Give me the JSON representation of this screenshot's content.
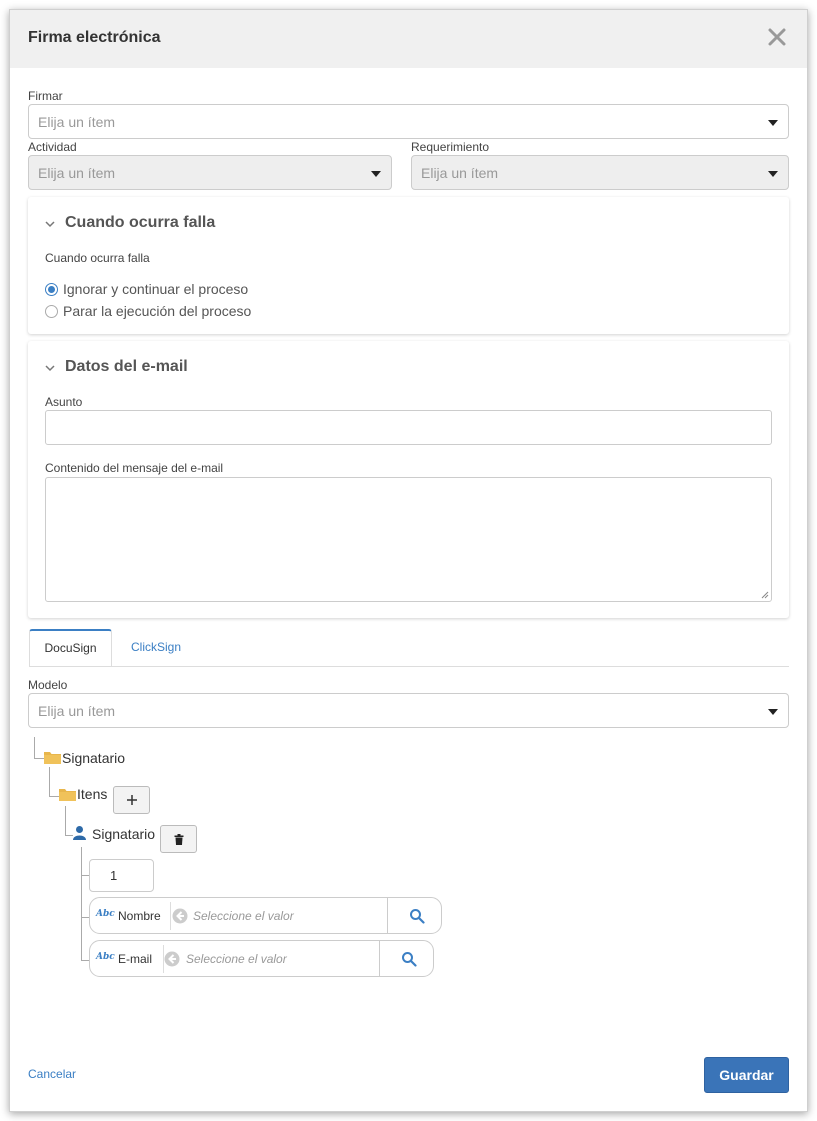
{
  "dialog": {
    "title": "Firma electrónica"
  },
  "firmar": {
    "label": "Firmar",
    "placeholder": "Elija un ítem"
  },
  "actividad": {
    "label": "Actividad",
    "placeholder": "Elija un ítem"
  },
  "requerimiento": {
    "label": "Requerimiento",
    "placeholder": "Elija un ítem"
  },
  "falla_panel": {
    "title": "Cuando ocurra falla",
    "field_label": "Cuando ocurra falla",
    "options": [
      {
        "label": "Ignorar y continuar el proceso",
        "selected": true
      },
      {
        "label": "Parar la ejecución del proceso",
        "selected": false
      }
    ]
  },
  "email_panel": {
    "title": "Datos del e-mail",
    "subject_label": "Asunto",
    "subject_value": "",
    "content_label": "Contenido del mensaje del e-mail",
    "content_value": ""
  },
  "tabs": [
    {
      "label": "DocuSign",
      "active": true
    },
    {
      "label": "ClickSign",
      "active": false
    }
  ],
  "modelo": {
    "label": "Modelo",
    "placeholder": "Elija un ítem"
  },
  "tree": {
    "root": "Signatario",
    "items": "Itens",
    "child": "Signatario",
    "index_value": "1",
    "fields": [
      {
        "type": "Abc",
        "name": "Nombre",
        "placeholder": "Seleccione el valor"
      },
      {
        "type": "Abc",
        "name": "E-mail",
        "placeholder": "Seleccione el valor"
      }
    ]
  },
  "footer": {
    "cancel": "Cancelar",
    "save": "Guardar"
  },
  "colors": {
    "accent": "#3b7fc4",
    "folder": "#e8b64c",
    "save_button": "#3a74b8"
  }
}
